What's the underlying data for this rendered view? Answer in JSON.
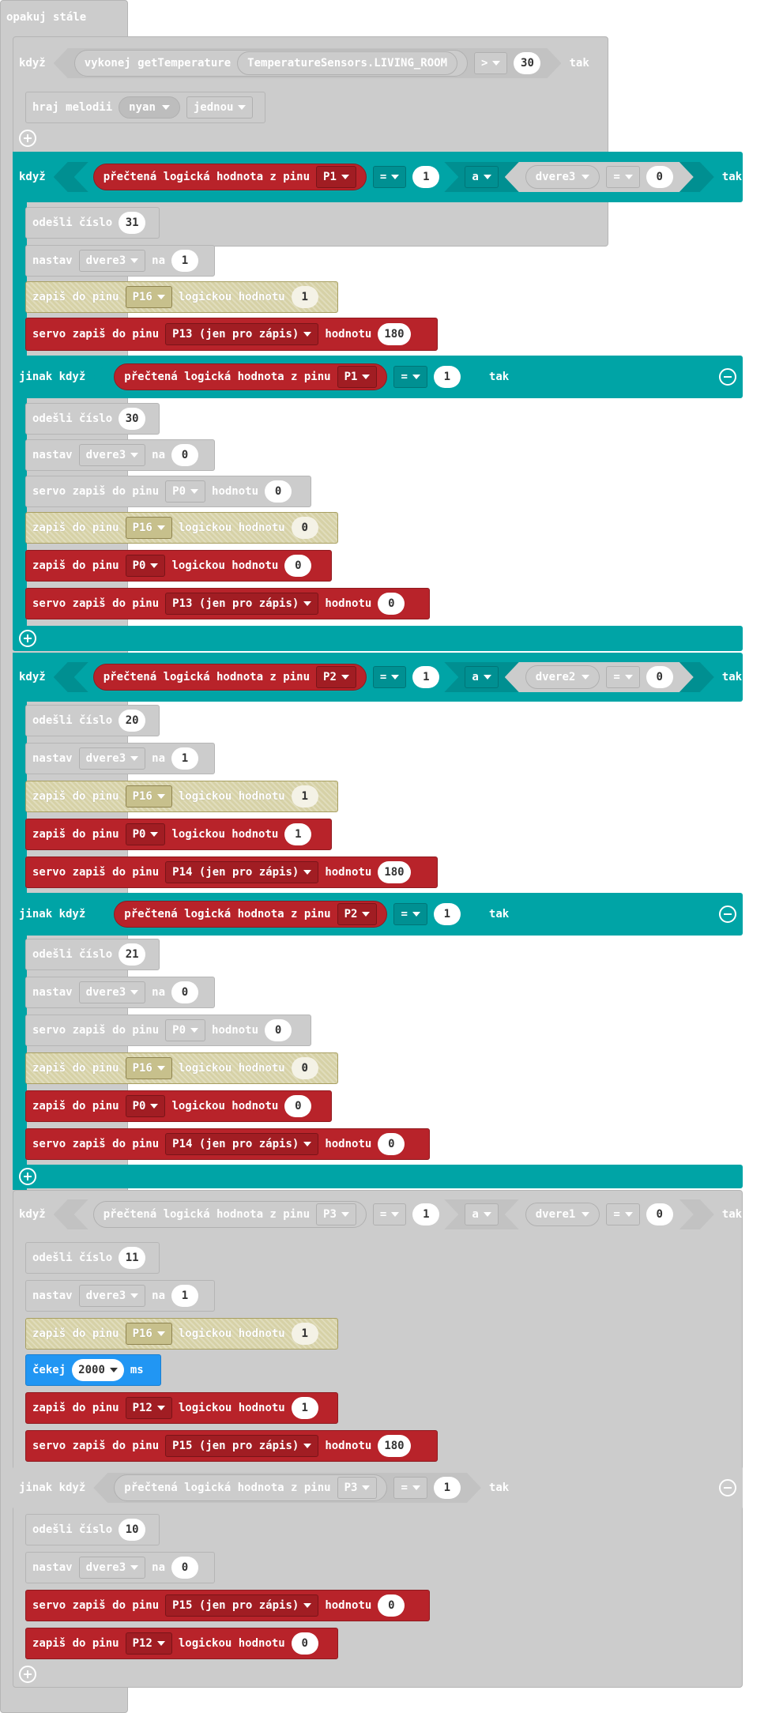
{
  "forever": {
    "label": "opakuj stále"
  },
  "kw": {
    "if": "když",
    "then": "tak",
    "elseif": "jinak když",
    "and": "a"
  },
  "if1": {
    "call": "vykonej getTemperature",
    "sensor": "TemperatureSensors.LIVING_ROOM",
    "op": ">",
    "value": "30",
    "body": {
      "melody_label": "hraj melodii",
      "melody": "nyan",
      "repeat": "jednou"
    }
  },
  "blocks": {
    "digital_read": "přečtená logická hodnota z pinu",
    "send": "odešli číslo",
    "set": "nastav",
    "to": "na",
    "digital_write": "zapiš do pinu",
    "logic_value": "logickou hodnotu",
    "servo_write": "servo zapiš do pinu",
    "servo_value": "hodnotu",
    "pause": "čekej",
    "ms": "ms",
    "eq": "="
  },
  "if2": {
    "cond": {
      "pin": "P1",
      "value": "1",
      "var": "dvere3",
      "var_value": "0"
    },
    "then": [
      {
        "type": "send",
        "value": "31"
      },
      {
        "type": "set",
        "var": "dvere3",
        "value": "1"
      },
      {
        "type": "write",
        "pin": "P16",
        "value": "1",
        "style": "olive"
      },
      {
        "type": "servo",
        "pin": "P13 (jen pro zápis)",
        "value": "180",
        "style": "red"
      }
    ],
    "elif": {
      "pin": "P1",
      "value": "1"
    },
    "else_then": [
      {
        "type": "send",
        "value": "30"
      },
      {
        "type": "set",
        "var": "dvere3",
        "value": "0"
      },
      {
        "type": "servo",
        "pin": "P0",
        "value": "0",
        "style": "gray"
      },
      {
        "type": "write",
        "pin": "P16",
        "value": "0",
        "style": "olive"
      },
      {
        "type": "write",
        "pin": "P0",
        "value": "0",
        "style": "red"
      },
      {
        "type": "servo",
        "pin": "P13 (jen pro zápis)",
        "value": "0",
        "style": "red"
      }
    ]
  },
  "if3": {
    "cond": {
      "pin": "P2",
      "value": "1",
      "var": "dvere2",
      "var_value": "0"
    },
    "then": [
      {
        "type": "send",
        "value": "20"
      },
      {
        "type": "set",
        "var": "dvere3",
        "value": "1"
      },
      {
        "type": "write",
        "pin": "P16",
        "value": "1",
        "style": "olive"
      },
      {
        "type": "write",
        "pin": "P0",
        "value": "1",
        "style": "red"
      },
      {
        "type": "servo",
        "pin": "P14 (jen pro zápis)",
        "value": "180",
        "style": "red"
      }
    ],
    "elif": {
      "pin": "P2",
      "value": "1"
    },
    "else_then": [
      {
        "type": "send",
        "value": "21"
      },
      {
        "type": "set",
        "var": "dvere3",
        "value": "0"
      },
      {
        "type": "servo",
        "pin": "P0",
        "value": "0",
        "style": "gray"
      },
      {
        "type": "write",
        "pin": "P16",
        "value": "0",
        "style": "olive"
      },
      {
        "type": "write",
        "pin": "P0",
        "value": "0",
        "style": "red"
      },
      {
        "type": "servo",
        "pin": "P14 (jen pro zápis)",
        "value": "0",
        "style": "red"
      }
    ]
  },
  "if4": {
    "cond": {
      "pin": "P3",
      "value": "1",
      "var": "dvere1",
      "var_value": "0"
    },
    "then": [
      {
        "type": "send",
        "value": "11"
      },
      {
        "type": "set",
        "var": "dvere3",
        "value": "1"
      },
      {
        "type": "write",
        "pin": "P16",
        "value": "1",
        "style": "olive"
      },
      {
        "type": "pause",
        "value": "2000"
      },
      {
        "type": "write",
        "pin": "P12",
        "value": "1",
        "style": "red"
      },
      {
        "type": "servo",
        "pin": "P15 (jen pro zápis)",
        "value": "180",
        "style": "red"
      }
    ],
    "elif": {
      "pin": "P3",
      "value": "1"
    },
    "else_then": [
      {
        "type": "send",
        "value": "10"
      },
      {
        "type": "set",
        "var": "dvere3",
        "value": "0"
      },
      {
        "type": "servo",
        "pin": "P15 (jen pro zápis)",
        "value": "0",
        "style": "red"
      },
      {
        "type": "write",
        "pin": "P12",
        "value": "0",
        "style": "red"
      }
    ]
  }
}
